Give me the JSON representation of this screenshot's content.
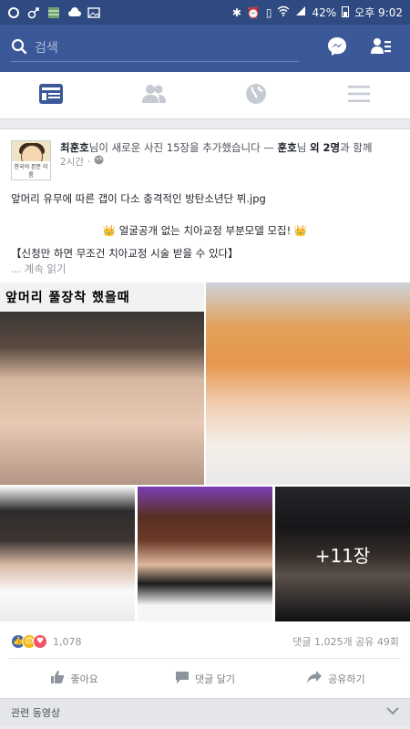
{
  "status_bar": {
    "battery": "42%",
    "time": "오후 9:02"
  },
  "header": {
    "search_placeholder": "검색",
    "icons": [
      "search-icon",
      "messenger-icon",
      "friend-requests-icon"
    ]
  },
  "nav_tabs": [
    {
      "name": "news-feed",
      "icon": "newsfeed-icon",
      "active": true
    },
    {
      "name": "friends",
      "icon": "friends-icon",
      "active": false
    },
    {
      "name": "notifications",
      "icon": "globe-icon",
      "active": false
    },
    {
      "name": "menu",
      "icon": "menu-icon",
      "active": false
    }
  ],
  "post": {
    "avatar_caption": "한국어 본문 이름",
    "author": "최훈호",
    "action": "님이 새로운 사진 15장을 추가했습니다 — ",
    "tagged": "훈호",
    "tagged_suffix": "님 ",
    "others": "외 2명",
    "with": "과 함께",
    "time": "2시간",
    "title": "앞머리 유무에 따른 갭이 다소 충격적인 방탄소년단 뷔.jpg",
    "promo_crown": "👑",
    "promo": "얼굴공개 없는 치아교정 부분모델 모집!",
    "promo_detail": "【신청만 하면 무조건 치아교정 시술 받을 수 있다】",
    "see_more": "... 계속 읽기",
    "photo_caption": "앞머리 풀장착 했을때",
    "more_photos": "+11장",
    "reaction_count": "1,078",
    "comments_shares": "댓글 1,025개  공유 49회",
    "like_label": "좋아요",
    "comment_label": "댓글 달기",
    "share_label": "공유하기"
  },
  "related": {
    "label": "관련 동영상"
  },
  "colors": {
    "fb_blue": "#3b5998",
    "status_blue": "#2f4a80",
    "background": "#e9ebee"
  }
}
